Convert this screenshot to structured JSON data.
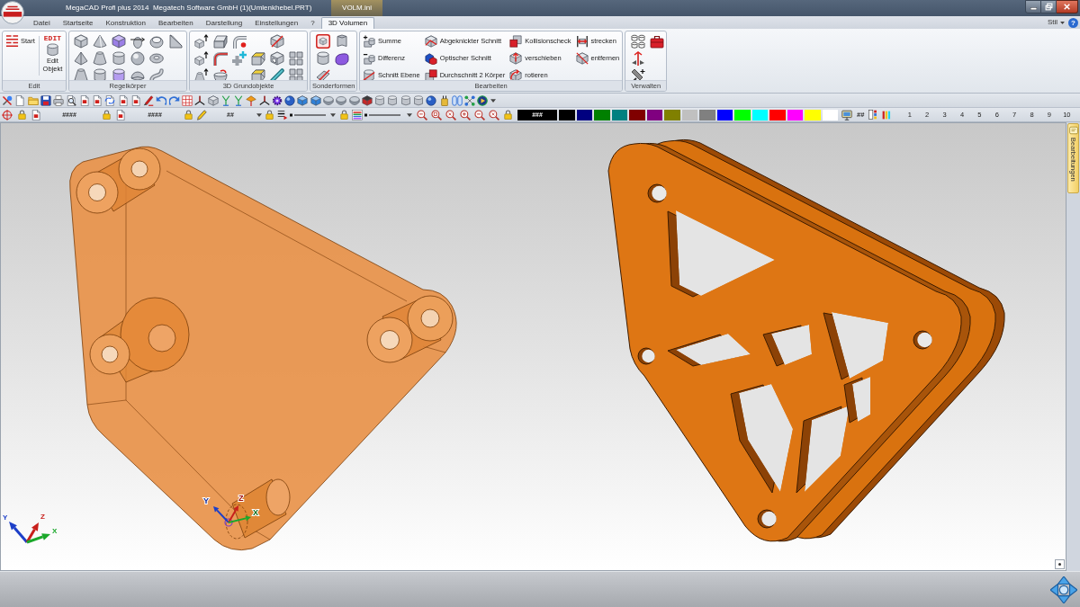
{
  "window": {
    "title": "MegaCAD Profi plus 2014  Megatech Software GmbH (1)(Umlenkhebel.PRT)",
    "context_tab": "VOLM.ini"
  },
  "ribbon": {
    "tabs": [
      {
        "label": "Datei",
        "selected": false
      },
      {
        "label": "Startseite",
        "selected": false
      },
      {
        "label": "Konstruktion",
        "selected": false
      },
      {
        "label": "Bearbeiten",
        "selected": false
      },
      {
        "label": "Darstellung",
        "selected": false
      },
      {
        "label": "Einstellungen",
        "selected": false
      },
      {
        "label": "?",
        "selected": false
      },
      {
        "label": "3D Volumen",
        "selected": true
      }
    ],
    "style_menu": "Stil",
    "help_button": "?",
    "groups": [
      {
        "kind": "edit",
        "title": "Edit",
        "start_label": "Start",
        "edit_badge": "EDIT",
        "edit_label": "Edit Objekt"
      },
      {
        "kind": "icons",
        "title": "Regelkörper"
      },
      {
        "kind": "icons",
        "title": "3D Grundobjekte"
      },
      {
        "kind": "icons",
        "title": "Sonderformen"
      },
      {
        "kind": "commands",
        "title": "Bearbeiten",
        "columns": [
          [
            "Summe",
            "Differenz",
            "Schnitt Ebene"
          ],
          [
            "Abgeknickter Schnitt",
            "Optischer Schnitt",
            "Durchschnitt 2 Körper"
          ],
          [
            "Kollisionscheck",
            "verschieben",
            "rotieren"
          ],
          [
            "strecken",
            "entfernen"
          ]
        ]
      },
      {
        "kind": "icons",
        "title": "Verwalten"
      }
    ]
  },
  "property_bar": {
    "fields": [
      {
        "kind": "text",
        "value": "####"
      },
      {
        "kind": "text",
        "value": "####"
      },
      {
        "kind": "dropdown",
        "value": "##"
      }
    ],
    "current_color": "###",
    "palette": [
      {
        "color": "#000000"
      },
      {
        "color": "#000080"
      },
      {
        "color": "#008000"
      },
      {
        "color": "#008080"
      },
      {
        "color": "#800000"
      },
      {
        "color": "#800080"
      },
      {
        "color": "#808000"
      },
      {
        "color": "#c0c0c0"
      },
      {
        "color": "#808080"
      },
      {
        "color": "#0000ff"
      },
      {
        "color": "#00ff00"
      },
      {
        "color": "#00ffff"
      },
      {
        "color": "#ff0000"
      },
      {
        "color": "#ff00ff"
      },
      {
        "color": "#ffff00"
      },
      {
        "color": "#ffffff"
      }
    ],
    "pattern_value": "##",
    "layers": [
      "1",
      "2",
      "3",
      "4",
      "5",
      "6",
      "7",
      "8",
      "9",
      "10"
    ]
  },
  "viewport": {
    "axis_labels": [
      "Y",
      "Z",
      "X"
    ],
    "part_axis_labels": [
      "Y",
      "Z",
      "X"
    ]
  },
  "side_panel": {
    "tab": "Bearbeitungen"
  }
}
